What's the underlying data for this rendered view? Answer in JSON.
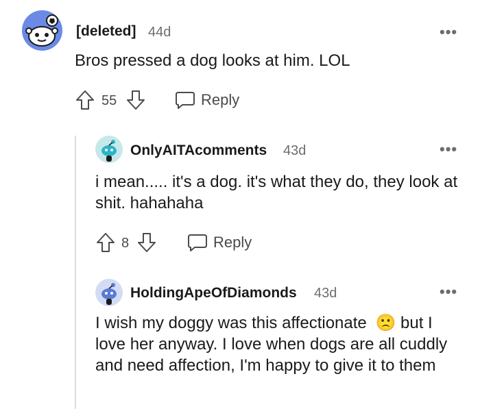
{
  "comments": [
    {
      "username": "[deleted]",
      "age": "44d",
      "text": "Bros pressed a dog looks at him. LOL",
      "score": "55",
      "reply_label": "Reply",
      "more": "•••"
    },
    {
      "username": "OnlyAITAcomments",
      "age": "43d",
      "text": "i mean..... it's a dog. it's what they do, they look at shit. hahahaha",
      "score": "8",
      "reply_label": "Reply",
      "more": "•••"
    },
    {
      "username": "HoldingApeOfDiamonds",
      "age": "43d",
      "text": "I wish my doggy was this affectionate",
      "text_rest": "but I love her anyway. I love when dogs are all cuddly and need affection, I'm happy to give it to them",
      "emoji": "🙁",
      "more": "•••"
    }
  ],
  "icons": {
    "upvote": "upvote-arrow-icon",
    "downvote": "downvote-arrow-icon",
    "reply": "reply-bubble-icon",
    "more": "more-options-icon"
  },
  "colors": {
    "text": "#1a1a1b",
    "muted": "#6b6d70",
    "thread_line": "#dcdcdc",
    "avatar_blue": "#5a7bd6"
  }
}
